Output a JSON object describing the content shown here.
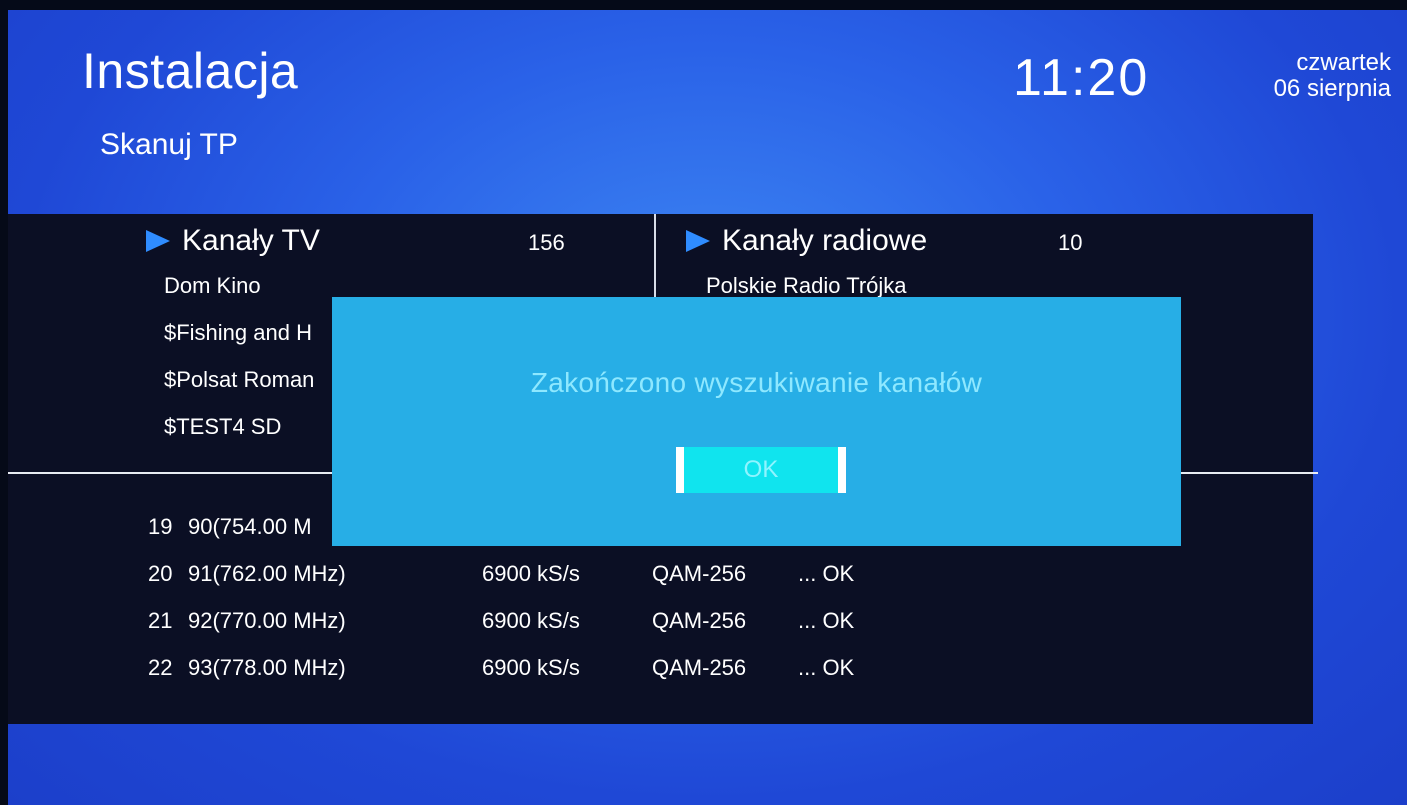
{
  "header": {
    "title": "Instalacja",
    "subtitle": "Skanuj TP",
    "time": "11:20",
    "weekday": "czwartek",
    "date": "06 sierpnia"
  },
  "tv": {
    "label": "Kanały TV",
    "count": "156",
    "channels": [
      "Dom Kino",
      "$Fishing and H",
      "$Polsat Roman",
      "$TEST4 SD"
    ]
  },
  "radio": {
    "label": "Kanały radiowe",
    "count": "10",
    "channels": [
      "Polskie Radio Trójka"
    ]
  },
  "scan_rows": [
    {
      "num": "19",
      "freq": "90(754.00 M",
      "rate": "",
      "mod": "",
      "status": ""
    },
    {
      "num": "20",
      "freq": "91(762.00 MHz)",
      "rate": "6900 kS/s",
      "mod": "QAM-256",
      "status": "... OK"
    },
    {
      "num": "21",
      "freq": "92(770.00 MHz)",
      "rate": "6900 kS/s",
      "mod": "QAM-256",
      "status": "... OK"
    },
    {
      "num": "22",
      "freq": "93(778.00 MHz)",
      "rate": "6900 kS/s",
      "mod": "QAM-256",
      "status": "... OK"
    }
  ],
  "dialog": {
    "message": "Zakończono wyszukiwanie kanałów",
    "ok_label": "OK"
  },
  "colors": {
    "background": "#2a62e8",
    "panel": "#0b0f24",
    "dialog": "#27aee6",
    "ok_button": "#10e4ee",
    "arrow": "#2f8cff"
  }
}
